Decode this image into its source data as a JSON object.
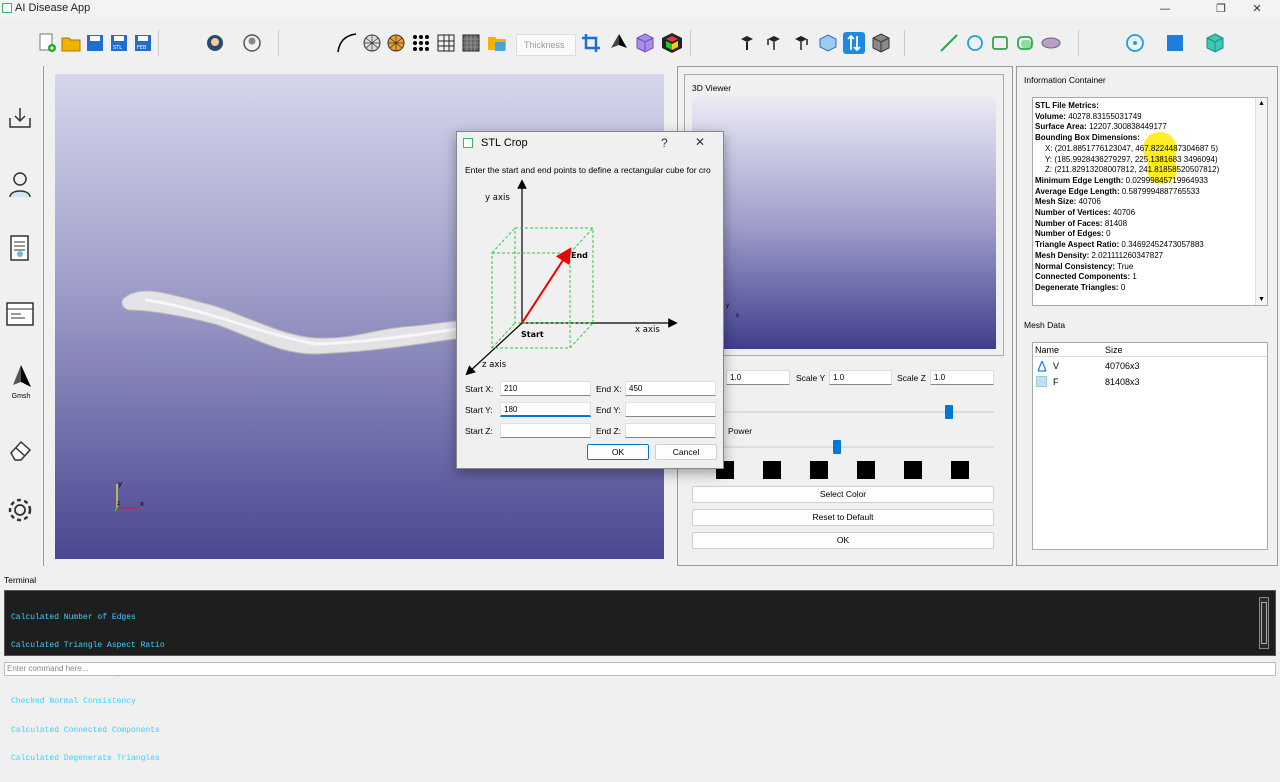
{
  "window": {
    "title": "AI Disease App",
    "minimize": "—",
    "maximize": "❐",
    "close": "✕"
  },
  "toolbar": {
    "thickness_placeholder": "Thickness"
  },
  "left_sidebar": {
    "gmsh_label": "Gmsh"
  },
  "viewer": {
    "title": "3D Viewer"
  },
  "controls": {
    "scale_x_value": "1.0",
    "scale_y_label": "Scale Y",
    "scale_y_value": "1.0",
    "scale_z_label": "Scale Z",
    "scale_z_value": "1.0",
    "power_label": "Power",
    "slider1_level": 0.85,
    "slider2_level": 0.48,
    "select_color": "Select Color",
    "reset_default": "Reset to Default",
    "ok": "OK"
  },
  "info": {
    "title": "Information Container",
    "header": "STL File Metrics:",
    "volume_label": "Volume:",
    "volume": "40278.83155031749",
    "surface_label": "Surface Area:",
    "surface": "12207.300838449177",
    "bbox_label": "Bounding Box Dimensions:",
    "bbox_x": "X: (201.8851776123047, 467.8224487304687 5)",
    "bbox_y": "Y: (185.9928436279297, 225.1381683 3496094)",
    "bbox_z": "Z: (211.82913208007812, 241.81858520507812)",
    "min_edge_label": "Minimum Edge Length:",
    "min_edge": "0.02999845719964933",
    "avg_edge_label": "Average Edge Length:",
    "avg_edge": "0.5879994887765533",
    "mesh_size_label": "Mesh Size:",
    "mesh_size": "40706",
    "vertices_label": "Number of Vertices:",
    "vertices": "40706",
    "faces_label": "Number of Faces:",
    "faces": "81408",
    "edges_label": "Number of Edges:",
    "edges": "0",
    "aspect_label": "Triangle Aspect Ratio:",
    "aspect": "0.34692452473057883",
    "density_label": "Mesh Density:",
    "density": "2.021111260347827",
    "normal_label": "Normal Consistency:",
    "normal": "True",
    "components_label": "Connected Components:",
    "components": "1",
    "degenerate_label": "Degenerate Triangles:",
    "degenerate": "0"
  },
  "mesh_data": {
    "title": "Mesh Data",
    "col_name": "Name",
    "col_size": "Size",
    "rows": [
      {
        "name": "V",
        "size": "40706x3"
      },
      {
        "name": "F",
        "size": "81408x3"
      }
    ]
  },
  "terminal": {
    "title": "Terminal",
    "lines": [
      "Calculated Number of Edges",
      "Calculated Triangle Aspect Ratio",
      "Calculated Mesh Density",
      "Checked Normal Consistency",
      "Calculated Connected Components",
      "Calculated Degenerate Triangles"
    ],
    "command_placeholder": "Enter command here..."
  },
  "dialog": {
    "title": "STL Crop",
    "help": "?",
    "close": "✕",
    "description": "Enter the start and end points to define a rectangular cube for cro",
    "diagram": {
      "y_axis": "y axis",
      "x_axis": "x axis",
      "z_axis": "z axis",
      "start": "Start",
      "end": "End"
    },
    "start_x_label": "Start X:",
    "start_x": "210",
    "end_x_label": "End X:",
    "end_x": "450",
    "start_y_label": "Start Y:",
    "start_y": "180",
    "end_y_label": "End Y:",
    "end_y": "",
    "start_z_label": "Start Z:",
    "start_z": "",
    "end_z_label": "End Z:",
    "end_z": "",
    "ok": "OK",
    "cancel": "Cancel"
  },
  "axes": {
    "x": "x",
    "y": "y",
    "z": "z"
  },
  "colors": {
    "accent": "#0078d4",
    "terminal_text": "#3fd0ff",
    "viewport_bottom": "#4a4791"
  }
}
